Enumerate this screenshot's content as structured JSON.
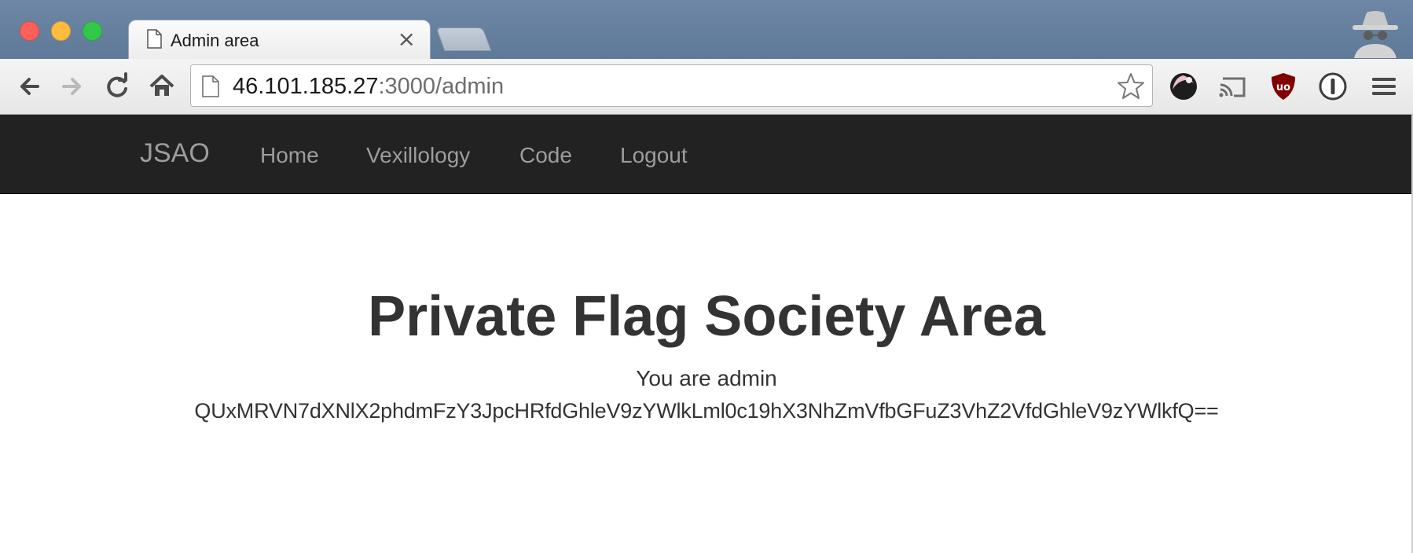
{
  "browser": {
    "tab": {
      "title": "Admin area",
      "close_glyph": "×"
    },
    "address": {
      "host": "46.101.185.27",
      "rest": ":3000/admin"
    },
    "icons": {
      "back": "back-arrow-icon",
      "forward": "forward-arrow-icon",
      "reload": "reload-icon",
      "home": "home-icon",
      "bookmark": "star-icon",
      "incognito": "incognito-icon",
      "extensions": [
        "extension-globe-icon",
        "cast-icon",
        "ublock-icon",
        "onepassword-icon",
        "menu-icon"
      ]
    },
    "colors": {
      "titlebar": "#6e87a6",
      "ublock": "#800000"
    }
  },
  "navbar": {
    "brand": "JSAO",
    "links": [
      "Home",
      "Vexillology",
      "Code",
      "Logout"
    ],
    "background": "#222222"
  },
  "main": {
    "title": "Private Flag Society Area",
    "subtitle": "You are admin",
    "flag": "QUxMRVN7dXNlX2phdmFzY3JpcHRfdGhleV9zYWlkLml0c19hX3NhZmVfbGFuZ3VhZ2VfdGhleV9zYWlkfQ=="
  }
}
